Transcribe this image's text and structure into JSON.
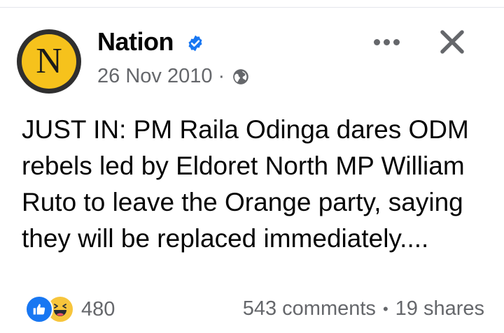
{
  "post": {
    "page_name": "Nation",
    "avatar_letter": "N",
    "date": "26 Nov 2010",
    "meta_separator": "·",
    "privacy_icon": "globe-icon",
    "text": "JUST IN: PM Raila Odinga dares ODM rebels led by Eldoret North MP William Ruto to leave the Orange party, saying they will be replaced immediately...."
  },
  "footer": {
    "reaction_count": "480",
    "comments": "543 comments",
    "separator": "•",
    "shares": "19 shares"
  },
  "colors": {
    "avatar_yellow": "#f6c21c",
    "verified_blue": "#1877f2",
    "like_blue": "#1877f2",
    "haha_yellow": "#f7c53c",
    "secondary_text": "#65676b"
  }
}
